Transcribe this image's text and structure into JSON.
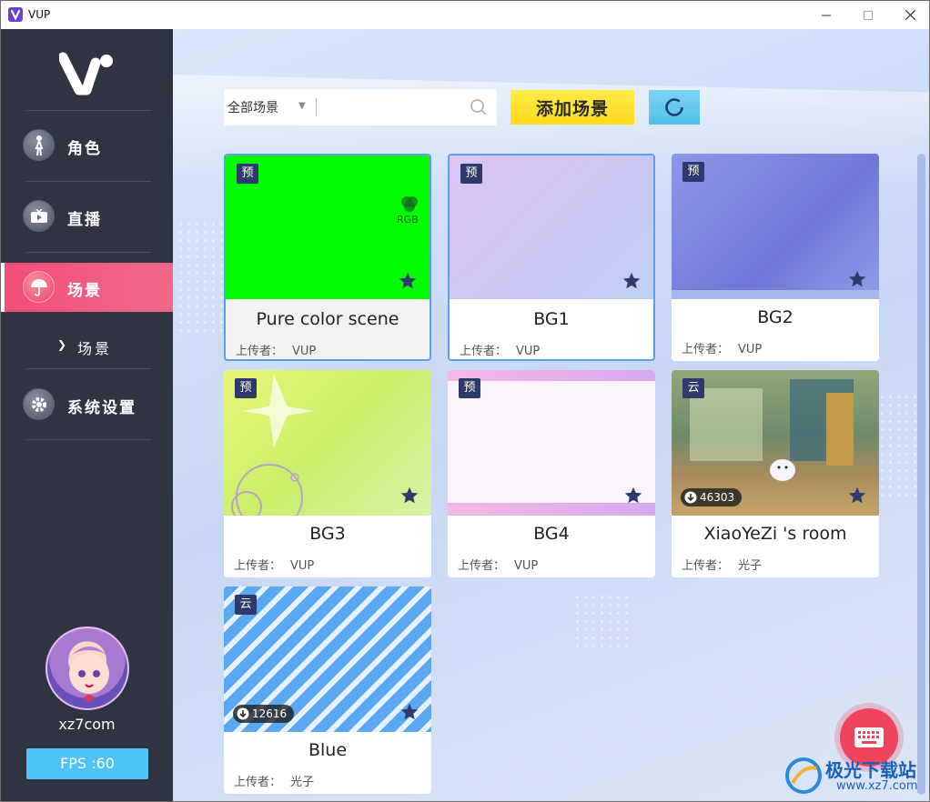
{
  "window": {
    "title": "VUP"
  },
  "sidebar": {
    "nav": [
      {
        "label": "角色",
        "icon": "character-icon"
      },
      {
        "label": "直播",
        "icon": "live-icon"
      },
      {
        "label": "场景",
        "icon": "umbrella-icon",
        "active": true
      },
      {
        "label": "系统设置",
        "icon": "gear-icon"
      }
    ],
    "sub_item": "场景",
    "user": {
      "name": "xz7com"
    },
    "fps": "FPS :60",
    "accent": "#f24d77"
  },
  "toolbar": {
    "filter_selected": "全部场景",
    "search_placeholder": "",
    "add_label": "添加场景"
  },
  "cards": [
    {
      "tag": "预",
      "name": "Pure color scene",
      "uploader_label": "上传者：",
      "uploader": "VUP",
      "thumb_text": "RGB"
    },
    {
      "tag": "预",
      "name": "BG1",
      "uploader_label": "上传者：",
      "uploader": "VUP"
    },
    {
      "tag": "预",
      "name": "BG2",
      "uploader_label": "上传者：",
      "uploader": "VUP"
    },
    {
      "tag": "预",
      "name": "BG3",
      "uploader_label": "上传者：",
      "uploader": "VUP"
    },
    {
      "tag": "预",
      "name": "BG4",
      "uploader_label": "上传者：",
      "uploader": "VUP"
    },
    {
      "tag": "云",
      "name": "XiaoYeZi 's room",
      "uploader_label": "上传者：",
      "uploader": "光子",
      "downloads": "46303"
    },
    {
      "tag": "云",
      "name": "Blue",
      "uploader_label": "上传者：",
      "uploader": "光子",
      "downloads": "12616"
    }
  ],
  "watermark": {
    "text": "极光下载站",
    "url": "www.xz7.com"
  }
}
